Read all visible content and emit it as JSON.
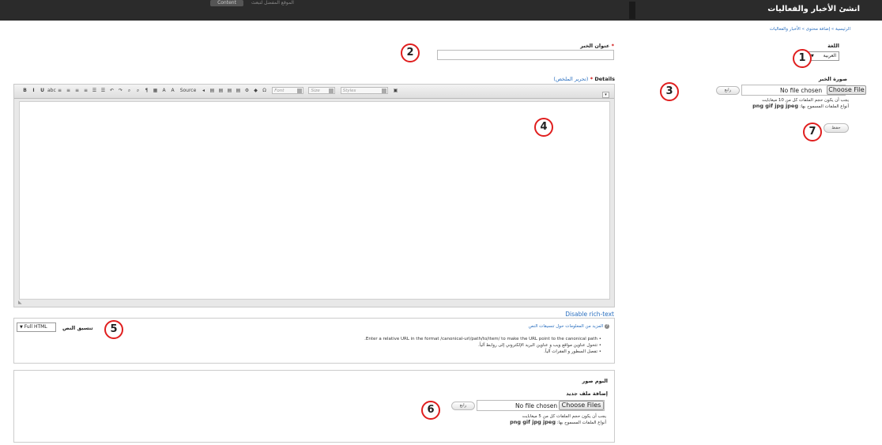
{
  "header": {
    "title": "انشئ الأخبار والفعاليات",
    "pill_label": "Content",
    "faded_text": "الموقع المفضل لتبعث"
  },
  "breadcrumb": "الرئيسية » إضافة محتوى » الأخبار والفعاليات",
  "language": {
    "label": "اللغة",
    "selected": "العربية"
  },
  "news_title": {
    "label": "عنوان الخبر",
    "required_mark": "*",
    "value": ""
  },
  "news_image": {
    "label": "صورة الخبر",
    "file_status": "No file chosen",
    "choose_button": "Choose File",
    "upload_button": "رابع",
    "help_size": "يجب أن يكون حجم الملفات كل من 10 ميغابايت",
    "help_types_label": "أنواع الملفات المسموح بها:",
    "help_types": "png gif jpg jpeg"
  },
  "save_button": "حفظ",
  "details": {
    "label": "Details",
    "required_mark": "*",
    "summary_link": "(تحرير الملخص)",
    "toolbar": {
      "buttons": [
        "B",
        "I",
        "U",
        "abc",
        "≡",
        "≡",
        "≡",
        "≡",
        "☰",
        "☰",
        "↶",
        "↷",
        "⌕",
        "⌕",
        "¶",
        "▦",
        "A",
        "A",
        "Source",
        "◂",
        "▤",
        "▤",
        "▤",
        "▤",
        "⚙",
        "◆",
        "Ω"
      ],
      "font_placeholder": "Font",
      "size_placeholder": "Size",
      "styles_placeholder": "Styles"
    },
    "disable_rich_text": "Disable rich-text"
  },
  "text_format": {
    "label": "تنسيق النص",
    "selected": "Full HTML",
    "more_info_link": "المزيد من المعلومات حول تنسيقات النص",
    "tips": [
      "Enter a relative URL in the format /canonical-url/path/to/item/ to make the URL point to the canonical path.",
      "تتحول عناوين مواقع ويب و عناوين البريد الإلكتروني إلى روابط آلياً.",
      "تفصل السطور و الفقرات آلياً."
    ]
  },
  "album": {
    "title": "البوم صور",
    "add_label": "إضافة ملف جديد",
    "file_status": "No file chosen",
    "choose_button": "Choose Files",
    "upload_button": "رابع",
    "help_size": "يجب أن يكون حجم الملفات كل من 5 ميغابايت",
    "help_types_label": "أنواع الملفات المسموح بها:",
    "help_types": "png gif jpg jpeg"
  },
  "callouts": [
    "1",
    "2",
    "3",
    "4",
    "5",
    "6",
    "7"
  ],
  "colors": {
    "callout_border": "#e01e1e",
    "header_bg": "#2b2b2b",
    "link": "#2a6fbf"
  }
}
